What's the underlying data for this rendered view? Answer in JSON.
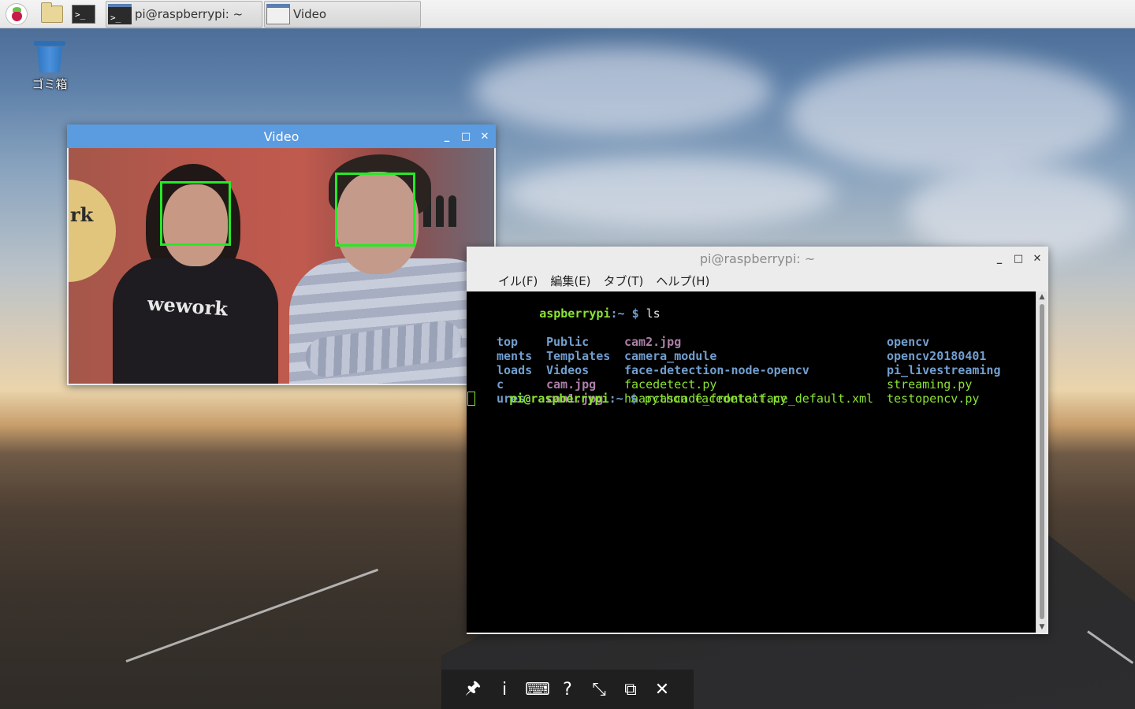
{
  "taskbar": {
    "tasks": [
      {
        "label": "pi@raspberrypi: ~"
      },
      {
        "label": "Video"
      }
    ],
    "terminal_glyph": ">_"
  },
  "desktop": {
    "trash_label": "ゴミ箱"
  },
  "video_window": {
    "title": "Video",
    "shirt_text": "wework",
    "badge_text": "rk",
    "box_color": "#27e827"
  },
  "terminal_window": {
    "title": "pi@raspberrypi: ~",
    "menu": [
      "イル(F)",
      "編集(E)",
      "タブ(T)",
      "ヘルプ(H)"
    ],
    "prompt_host": "aspberrypi",
    "prompt_tail": ":~ $ ",
    "cmd1": "ls",
    "ls_col1": [
      "top",
      "ments",
      "loads",
      "c",
      "ures"
    ],
    "ls_col2": [
      "Public",
      "Templates",
      "Videos",
      "cam.jpg",
      "cam1.jpg"
    ],
    "ls_col3": [
      "cam2.jpg",
      "camera_module",
      "face-detection-node-opencv",
      "facedetect.py",
      "haarcascade_frontalface_default.xml"
    ],
    "ls_col4": [
      "opencv",
      "opencv20180401",
      "pi_livestreaming",
      "streaming.py",
      "testopencv.py"
    ],
    "prompt2_prefix": "pi@r",
    "cmd2": "python facedetect.py"
  },
  "bottom_toolbar": {
    "pin": "🖈",
    "info": "i",
    "keyboard": "⌨",
    "help": "?",
    "shrink": "⤡",
    "fit": "⧉",
    "close": "✕"
  },
  "colors": {
    "titlebar_active": "#5b9be0",
    "term_green": "#8ae234",
    "term_blue": "#729fcf",
    "term_magenta": "#ad7fa8"
  }
}
